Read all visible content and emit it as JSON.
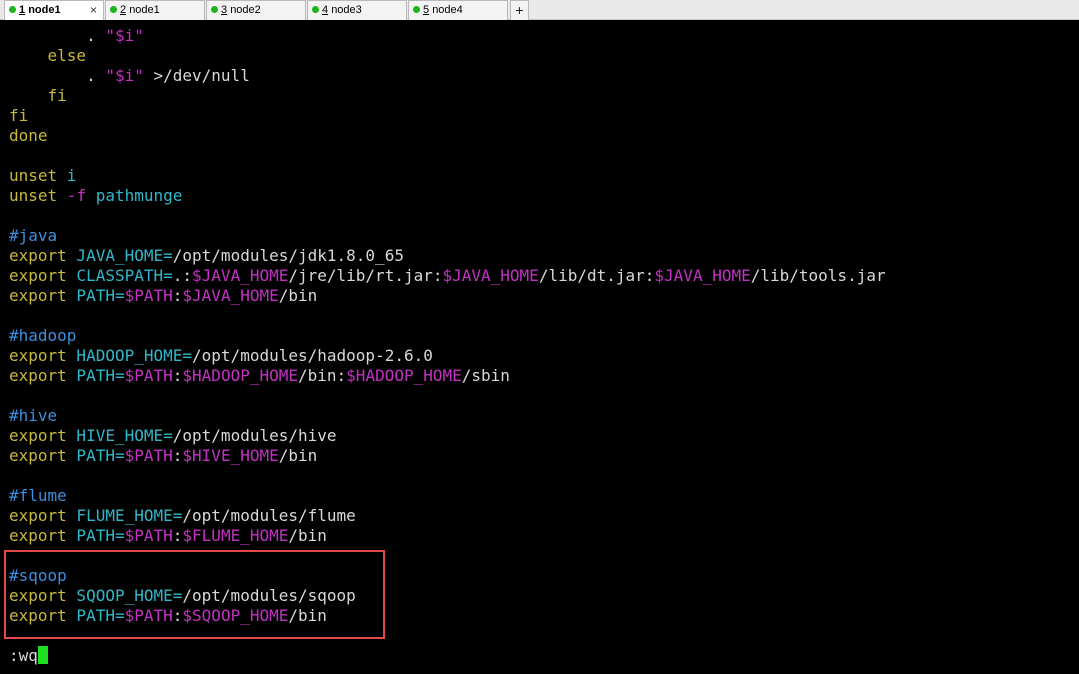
{
  "tabs": [
    {
      "num": "1",
      "name": "node1",
      "active": true,
      "close": "×"
    },
    {
      "num": "2",
      "name": "node1",
      "active": false
    },
    {
      "num": "3",
      "name": "node2",
      "active": false
    },
    {
      "num": "4",
      "name": "node3",
      "active": false
    },
    {
      "num": "5",
      "name": "node4",
      "active": false
    }
  ],
  "add_tab_label": "+",
  "lines": {
    "l0": {
      "a": "        . ",
      "b": "\"$i\""
    },
    "l1": {
      "a": "    else"
    },
    "l2": {
      "a": "        . ",
      "b": "\"$i\"",
      "c": " >/dev/null"
    },
    "l3": {
      "a": "    fi"
    },
    "l4": {
      "a": "fi"
    },
    "l5": {
      "a": "done"
    },
    "l7": {
      "a": "unset",
      "b": " i"
    },
    "l8": {
      "a": "unset",
      "b": " -f",
      "c": " pathmunge"
    },
    "l10": {
      "a": "#java"
    },
    "l11": {
      "a": "export",
      "b": " JAVA_HOME=",
      "c": "/opt/modules/jdk1.8.0_65"
    },
    "l12": {
      "a": "export",
      "b": " CLASSPATH=",
      "c": ".:",
      "d": "$JAVA_HOME",
      "e": "/jre/lib/rt.jar:",
      "f": "$JAVA_HOME",
      "g": "/lib/dt.jar:",
      "h": "$JAVA_HOME",
      "i": "/lib/tools.jar"
    },
    "l13": {
      "a": "export",
      "b": " PATH=",
      "c": "$PATH",
      "d": ":",
      "e": "$JAVA_HOME",
      "f": "/bin"
    },
    "l15": {
      "a": "#hadoop"
    },
    "l16": {
      "a": "export",
      "b": " HADOOP_HOME=",
      "c": "/opt/modules/hadoop-2.6.0"
    },
    "l17": {
      "a": "export",
      "b": " PATH=",
      "c": "$PATH",
      "d": ":",
      "e": "$HADOOP_HOME",
      "f": "/bin:",
      "g": "$HADOOP_HOME",
      "h": "/sbin"
    },
    "l19": {
      "a": "#hive"
    },
    "l20": {
      "a": "export",
      "b": " HIVE_HOME=",
      "c": "/opt/modules/hive"
    },
    "l21": {
      "a": "export",
      "b": " PATH=",
      "c": "$PATH",
      "d": ":",
      "e": "$HIVE_HOME",
      "f": "/bin"
    },
    "l23": {
      "a": "#flume"
    },
    "l24": {
      "a": "export",
      "b": " FLUME_HOME=",
      "c": "/opt/modules/flume"
    },
    "l25": {
      "a": "export",
      "b": " PATH=",
      "c": "$PATH",
      "d": ":",
      "e": "$FLUME_HOME",
      "f": "/bin"
    },
    "l27": {
      "a": "#sqoop"
    },
    "l28": {
      "a": "export",
      "b": " SQOOP_HOME=",
      "c": "/opt/modules/sqoop"
    },
    "l29": {
      "a": "export",
      "b": " PATH=",
      "c": "$PATH",
      "d": ":",
      "e": "$SQOOP_HOME",
      "f": "/bin"
    }
  },
  "command_line": ":wq",
  "colors": {
    "keyword": "#c7b93a",
    "variable_cyan": "#2fb7c9",
    "variable_magenta": "#c232c2",
    "comment": "#3c8fe0",
    "highlight_box": "#e34848",
    "cursor": "#1fe01f",
    "tab_connected_dot": "#1bb41b"
  }
}
